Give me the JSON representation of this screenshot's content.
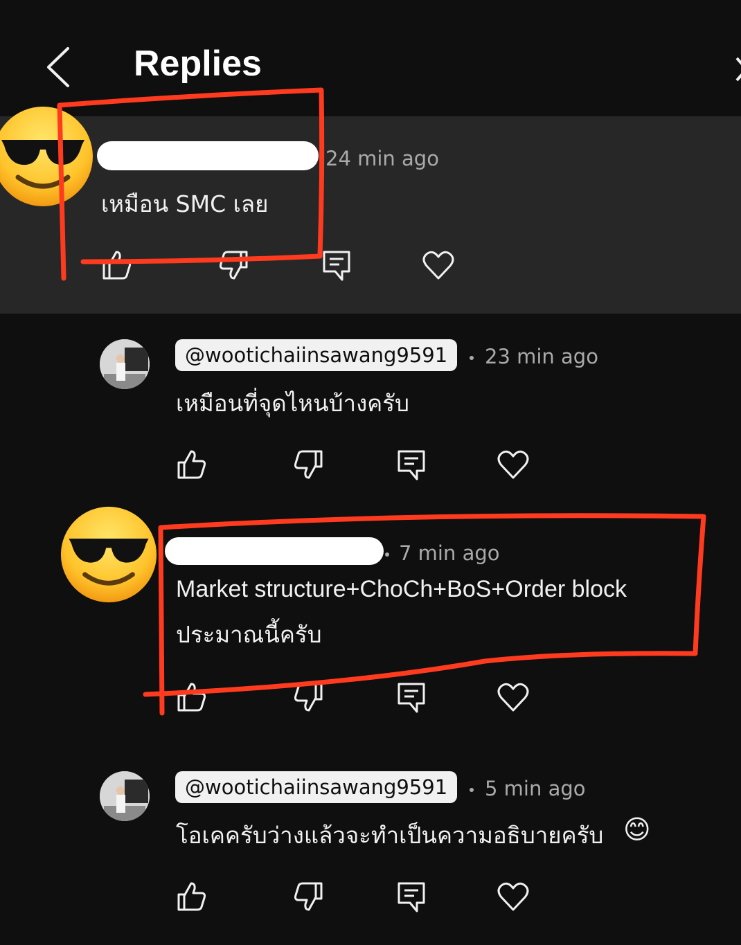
{
  "header": {
    "title": "Replies"
  },
  "comments": [
    {
      "timestamp": "24 min ago",
      "text": "เหมือน SMC เลย",
      "author_redacted": true,
      "avatar_icon": "sunglasses-emoji-avatar"
    },
    {
      "author": "@wootichaiinsawang9591",
      "timestamp": "23 min ago",
      "text": "เหมือนที่จุดไหนบ้างครับ",
      "avatar_icon": "profile-photo-avatar"
    },
    {
      "timestamp": "7 min ago",
      "text_line1": "Market structure+ChoCh+BoS+Order block",
      "text_line2": "ประมาณนี้ครับ",
      "author_redacted": true,
      "avatar_icon": "sunglasses-emoji-avatar"
    },
    {
      "author": "@wootichaiinsawang9591",
      "timestamp": "5 min ago",
      "text": "โอเคครับว่างแล้วจะทำเป็นความอธิบายครับ",
      "emoji": "😊",
      "avatar_icon": "profile-photo-avatar"
    }
  ],
  "actions": [
    "like-icon",
    "dislike-icon",
    "reply-icon",
    "heart-icon"
  ],
  "colors": {
    "background": "#0f0f0f",
    "highlight": "#272727",
    "annotation": "#ff3b1f",
    "meta_text": "#aaaaaa"
  }
}
